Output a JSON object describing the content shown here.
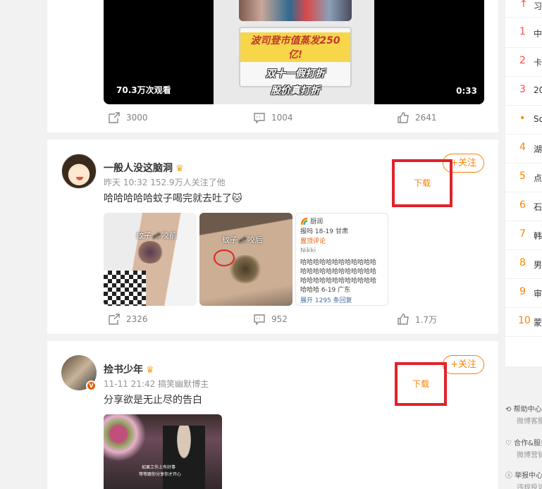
{
  "video_card": {
    "thumb_line1": "波司登市值蒸发250亿!",
    "thumb_line2": "双十一假打折",
    "thumb_line3": "股价真打折",
    "views": "70.3万次观看",
    "duration": "0:33",
    "reposts": "3000",
    "comments": "1004",
    "likes": "2641"
  },
  "post1": {
    "username": "一般人没这脑洞",
    "meta": "昨天 10:32  152.9万人关注了他",
    "text": "哈哈哈哈哈蚊子喝完就去吐了🐱",
    "follow_label": "+关注",
    "download_label": "下载",
    "image1_caption": "蚊子🦟咬前",
    "image2_caption": "蚊子🦟咬后",
    "image3_lines": [
      "🌈 厨润",
      "报吗 18-19 甘肃",
      "置顶评论",
      "Nikki",
      "哈哈哈哈哈哈哈哈哈哈哈哈",
      "哈哈哈哈哈哈哈哈哈哈哈哈",
      "哈哈哈哈哈哈哈哈哈哈哈哈",
      "哈哈哈 6-19 广东",
      "展开 1295 条回复"
    ],
    "reposts": "2326",
    "comments": "952",
    "likes": "1.7万"
  },
  "post2": {
    "username": "捡书少年",
    "meta": "11-11 21:42  搞笑幽默博主",
    "text": "分享欲是无止尽的告白",
    "follow_label": "+关注",
    "download_label": "下载",
    "image_subtitle1": "如果工作上有好事",
    "image_subtitle2": "等等跟你分享你才开心"
  },
  "sidebar": {
    "hot_items": [
      {
        "rank": "↑",
        "title": "习",
        "color": "#ff4a4a"
      },
      {
        "rank": "1",
        "title": "中",
        "color": "#ff4a4a"
      },
      {
        "rank": "2",
        "title": "卡",
        "color": "#ff4a4a"
      },
      {
        "rank": "3",
        "title": "20",
        "color": "#ff4a4a"
      },
      {
        "rank": "•",
        "title": "So",
        "color": "#ff8200"
      },
      {
        "rank": "4",
        "title": "湖",
        "color": "#ff8200"
      },
      {
        "rank": "5",
        "title": "点",
        "color": "#ff8200"
      },
      {
        "rank": "6",
        "title": "石",
        "color": "#ff8200"
      },
      {
        "rank": "7",
        "title": "韩",
        "color": "#ff8200"
      },
      {
        "rank": "8",
        "title": "男",
        "color": "#ff8200"
      },
      {
        "rank": "9",
        "title": "审",
        "color": "#ff8200"
      },
      {
        "rank": "10",
        "title": "蒙",
        "color": "#ff8200"
      }
    ],
    "footer": [
      {
        "title": "帮助中心",
        "sub": "微博客服"
      },
      {
        "title": "合作&服务",
        "sub": "微博营销"
      },
      {
        "title": "举报中心",
        "sub": "违规投诉"
      }
    ]
  }
}
